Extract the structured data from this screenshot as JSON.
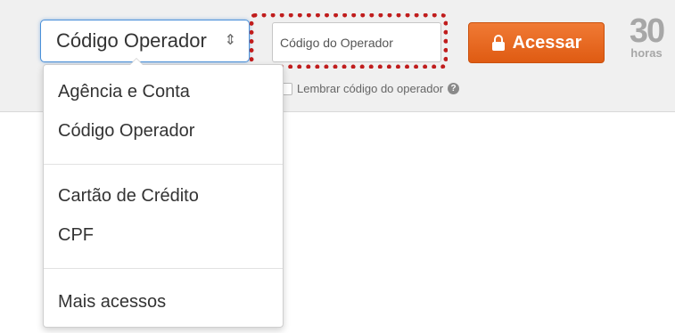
{
  "login_bar": {
    "selector": {
      "value": "Código Operador",
      "arrow": "⇕"
    },
    "operator_input": {
      "placeholder": "Código do Operador"
    },
    "access_button": {
      "label": "Acessar",
      "icon": "lock-icon"
    },
    "badge": {
      "number": "30",
      "unit": "horas"
    },
    "remember": {
      "label": "Lembrar código do operador",
      "help_icon": "?"
    }
  },
  "dropdown": {
    "groups": [
      [
        "Agência e Conta",
        "Código Operador"
      ],
      [
        "Cartão de Crédito",
        "CPF"
      ],
      [
        "Mais acessos"
      ]
    ]
  },
  "colors": {
    "accent_orange": "#e8661f",
    "focus_blue": "#4a90d9",
    "highlight_red": "#c01d1d",
    "bar_bg": "#f0f0f0"
  }
}
